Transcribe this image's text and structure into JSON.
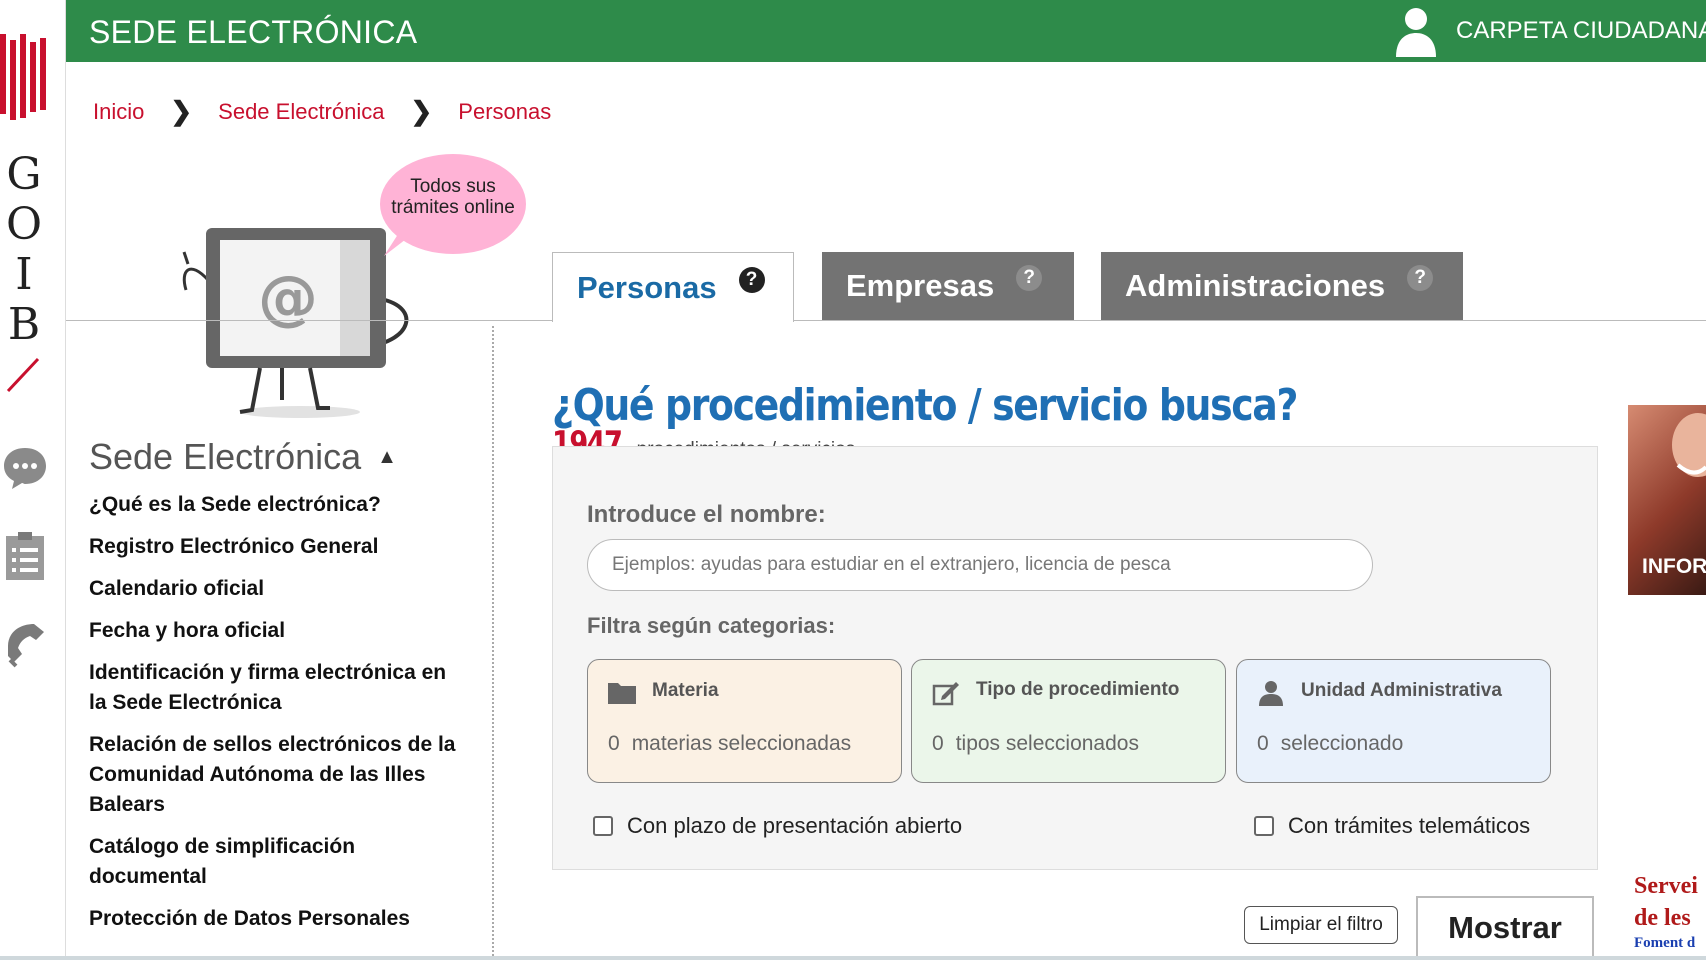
{
  "header": {
    "title": "SEDE ELECTRÓNICA",
    "carpeta": "CARPETA CIUDADANA"
  },
  "brand": {
    "letters": [
      "G",
      "O",
      "I",
      "B"
    ],
    "accent": "#c8102e",
    "bar_color": "#2e8b4a"
  },
  "breadcrumb": [
    "Inicio",
    "Sede Electrónica",
    "Personas"
  ],
  "mascot": {
    "bubble_line1": "Todos sus",
    "bubble_line2": "trámites online",
    "screen_symbol": "@"
  },
  "tabs": [
    {
      "label": "Personas",
      "help": "?",
      "active": true
    },
    {
      "label": "Empresas",
      "help": "?",
      "active": false
    },
    {
      "label": "Administraciones",
      "help": "?",
      "active": false
    }
  ],
  "sidebar": {
    "title": "Sede Electrónica",
    "items": [
      "¿Qué es la Sede electrónica?",
      "Registro Electrónico General",
      "Calendario oficial",
      "Fecha y hora oficial",
      "Identificación y firma electrónica en la Sede Electrónica",
      "Relación de sellos electrónicos de la Comunidad Autónoma de las Illes Balears",
      "Catálogo de simplificación documental",
      "Protección de Datos Personales"
    ]
  },
  "main": {
    "question": "¿Qué procedimiento / servicio busca?",
    "count": "1947",
    "count_label": "procedimientos / servicios",
    "name_label": "Introduce el nombre:",
    "search_placeholder": "Ejemplos: ayudas para estudiar en el extranjero, licencia de pesca",
    "filter_label": "Filtra según categorias:",
    "cards": [
      {
        "title": "Materia",
        "count": "0",
        "value": "materias seleccionadas",
        "icon": "folder-icon"
      },
      {
        "title": "Tipo de procedimiento",
        "count": "0",
        "value": "tipos seleccionados",
        "icon": "edit-icon"
      },
      {
        "title": "Unidad Administrativa",
        "count": "0",
        "value": "seleccionado",
        "icon": "user-icon"
      }
    ],
    "check_plazo": "Con plazo de presentación abierto",
    "check_telematicos": "Con trámites telemáticos",
    "clear_button": "Limpiar el filtro",
    "show_button": "Mostrar"
  },
  "right": {
    "banner_text": "INFOR",
    "serv_line1": "Servei",
    "serv_line2": "de les",
    "serv_line3": "Foment d"
  }
}
